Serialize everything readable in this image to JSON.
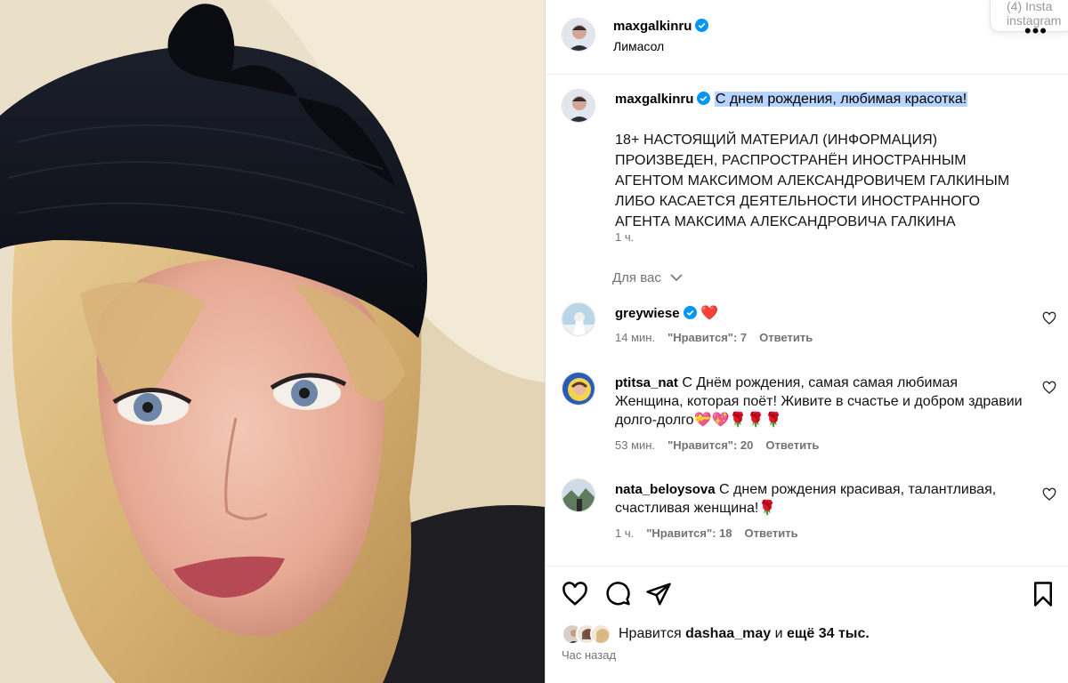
{
  "notification": {
    "line1": "(4) Insta",
    "line2": "instagram"
  },
  "post": {
    "author": "maxgalkinru",
    "location": "Лимасол",
    "more_label": "•••"
  },
  "caption": {
    "author": "maxgalkinru",
    "headline": "С днем рождения, любимая красотка!",
    "body": "18+ НАСТОЯЩИЙ МАТЕРИАЛ (ИНФОРМАЦИЯ) ПРОИЗВЕДЕН, РАСПРОСТРАНЁН ИНОСТРАННЫМ АГЕНТОМ МАКСИМОМ АЛЕКСАНДРОВИЧЕМ ГАЛКИНЫМ ЛИБО КАСАЕТСЯ ДЕЯТЕЛЬНОСТИ ИНОСТРАННОГО АГЕНТА МАКСИМА АЛЕКСАНДРОВИЧА ГАЛКИНА",
    "time": "1 ч."
  },
  "filter": {
    "label": "Для вас"
  },
  "comments": [
    {
      "user": "greywiese",
      "verified": true,
      "text": "❤️",
      "time": "14 мин.",
      "likes": "\"Нравится\": 7",
      "reply": "Ответить"
    },
    {
      "user": "ptitsa_nat",
      "verified": false,
      "text": "С Днём рождения, самая самая любимая Женщина, которая поёт! Живите в счастье и добром здравии долго-долго💝💖🌹🌹🌹",
      "time": "53 мин.",
      "likes": "\"Нравится\": 20",
      "reply": "Ответить"
    },
    {
      "user": "nata_beloysova",
      "verified": false,
      "text": "С днем рождения красивая, талантливая, счастливая женщина!🌹",
      "time": "1 ч.",
      "likes": "\"Нравится\": 18",
      "reply": "Ответить"
    }
  ],
  "actions": {
    "icons": [
      "heart-icon",
      "comment-icon",
      "share-icon",
      "bookmark-icon"
    ],
    "likes_prefix": "Нравится",
    "likes_user": "dashaa_may",
    "likes_and": "и",
    "likes_rest": "ещё 34 тыс.",
    "posted_ago": "Час назад"
  },
  "colors": {
    "verified": "#0095f6",
    "highlight": "#b7d4ff",
    "muted": "#737373"
  }
}
